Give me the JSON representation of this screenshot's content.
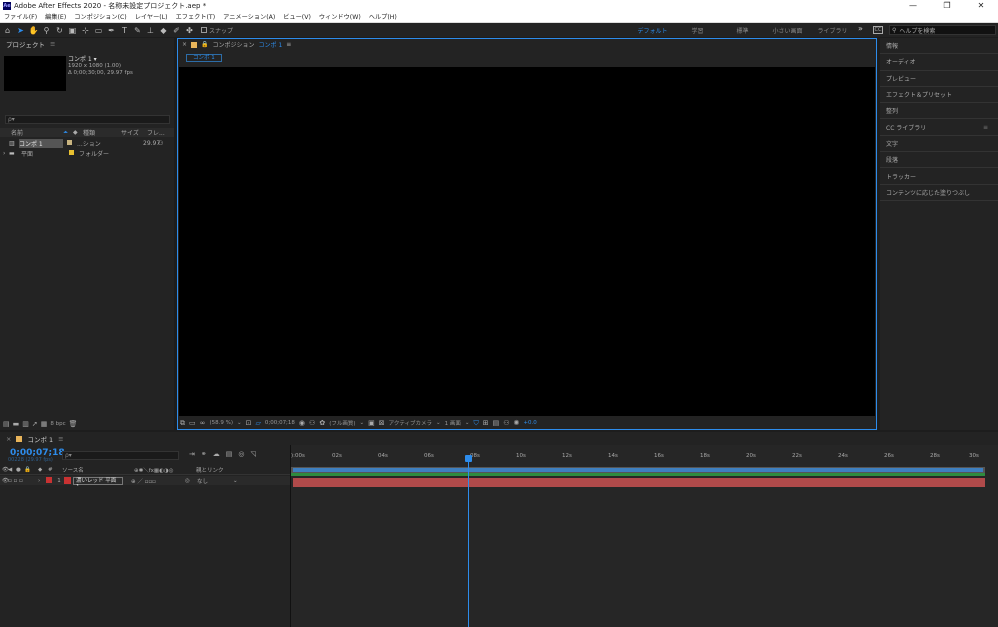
{
  "window": {
    "title": "Adobe After Effects 2020 - 名称未設定プロジェクト.aep *",
    "app_icon": "Ae",
    "btn_min": "—",
    "btn_max": "❐",
    "btn_close": "✕"
  },
  "menu": [
    "ファイル(F)",
    "編集(E)",
    "コンポジション(C)",
    "レイヤー(L)",
    "エフェクト(T)",
    "アニメーション(A)",
    "ビュー(V)",
    "ウィンドウ(W)",
    "ヘルプ(H)"
  ],
  "toolbar": {
    "snap_label": "スナップ",
    "workspaces": [
      "デフォルト",
      "学習",
      "標準",
      "小さい画面",
      "ライブラリ"
    ],
    "active_workspace": "デフォルト",
    "more": "»",
    "cc_icon": "CC",
    "help_search_placeholder": "ヘルプを検索",
    "accent_color": "#2d8ceb"
  },
  "project": {
    "title": "プロジェクト",
    "menu_icon": "≡",
    "selected_item": {
      "name": "コンポ 1 ▾",
      "size": "1920 x 1080 (1.00)",
      "duration": "Δ 0;00;30;00, 29.97 fps"
    },
    "search_placeholder": "ρ▾",
    "columns": [
      "名前",
      "種類",
      "サイズ",
      "フレ..."
    ],
    "items": [
      {
        "name": "コンポ 1",
        "type": "...ション",
        "size": "",
        "fps": "29.97",
        "color": "#c8b480",
        "selected": true
      },
      {
        "name": "平面",
        "type": "フォルダー",
        "size": "",
        "fps": "",
        "color": "#e8c030",
        "selected": false
      }
    ],
    "bpc": "8 bpc"
  },
  "composition": {
    "tab_label": "コンポジション",
    "comp_name": "コンポ 1",
    "subtab": "コンポ 1",
    "zoom": "(58.9 %)",
    "timecode": "0;00;07;18",
    "resolution": "(フル画質)",
    "camera": "アクティブカメラ",
    "views": "1 画面",
    "exposure": "+0.0"
  },
  "right_panel": {
    "items": [
      "情報",
      "オーディオ",
      "プレビュー",
      "エフェクト＆プリセット",
      "整列",
      "CC ライブラリ",
      "文字",
      "段落",
      "トラッカー",
      "コンテンツに応じた塗りつぶし"
    ]
  },
  "timeline": {
    "tab": "コンポ 1",
    "menu_icon": "≡",
    "current_time": "0;00;07;18",
    "fps_label": "00228 (29.97 fps)",
    "search_placeholder": "ρ▾",
    "col_source": "ソース名",
    "col_parent": "親とリンク",
    "layer": {
      "index": "1",
      "name": "濃いレッド 平面 1",
      "parent": "なし",
      "color": "#c83232"
    },
    "ruler": [
      "):00s",
      "02s",
      "04s",
      "06s",
      "08s",
      "10s",
      "12s",
      "14s",
      "16s",
      "18s",
      "20s",
      "22s",
      "24s",
      "26s",
      "28s",
      "30s"
    ],
    "playhead_seconds": 7.6,
    "duration_seconds": 30
  }
}
